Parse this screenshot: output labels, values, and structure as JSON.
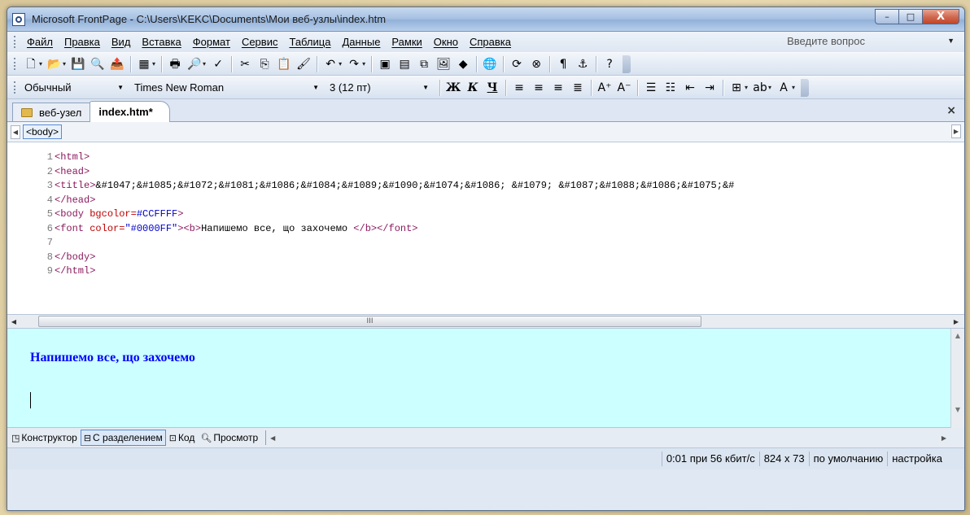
{
  "window": {
    "title": "Microsoft FrontPage - C:\\Users\\KEKC\\Documents\\Мои веб-узлы\\index.htm",
    "minimize": "–",
    "maximize": "□",
    "close": "X"
  },
  "menu": {
    "items": [
      "Файл",
      "Правка",
      "Вид",
      "Вставка",
      "Формат",
      "Сервис",
      "Таблица",
      "Данные",
      "Рамки",
      "Окно",
      "Справка"
    ],
    "ask_placeholder": "Введите вопрос",
    "ask_dropdown": "▼"
  },
  "toolbar_standard": {
    "icons": [
      {
        "name": "new-page-icon",
        "glyph": "🗋",
        "dropdown": true
      },
      {
        "name": "open-folder-icon",
        "glyph": "📂",
        "dropdown": true
      },
      {
        "name": "save-icon",
        "glyph": "💾"
      },
      {
        "name": "search-icon",
        "glyph": "🔍"
      },
      {
        "name": "publish-icon",
        "glyph": "📤"
      },
      {
        "name": "sep"
      },
      {
        "name": "toggle-pane-icon",
        "glyph": "▦",
        "dropdown": true
      },
      {
        "name": "sep"
      },
      {
        "name": "print-icon",
        "glyph": "🖶"
      },
      {
        "name": "print-preview-icon",
        "glyph": "🔎",
        "dropdown": true
      },
      {
        "name": "spelling-icon",
        "glyph": "✓"
      },
      {
        "name": "sep"
      },
      {
        "name": "cut-icon",
        "glyph": "✂"
      },
      {
        "name": "copy-icon",
        "glyph": "⎘"
      },
      {
        "name": "paste-icon",
        "glyph": "📋"
      },
      {
        "name": "format-painter-icon",
        "glyph": "🖌"
      },
      {
        "name": "sep"
      },
      {
        "name": "undo-icon",
        "glyph": "↶",
        "dropdown": true
      },
      {
        "name": "redo-icon",
        "glyph": "↷",
        "dropdown": true
      },
      {
        "name": "sep"
      },
      {
        "name": "web-component-icon",
        "glyph": "▣"
      },
      {
        "name": "insert-table-icon",
        "glyph": "▤"
      },
      {
        "name": "insert-layer-icon",
        "glyph": "⧉"
      },
      {
        "name": "insert-picture-icon",
        "glyph": "🖼"
      },
      {
        "name": "drawing-icon",
        "glyph": "◆"
      },
      {
        "name": "sep"
      },
      {
        "name": "hyperlink-icon",
        "glyph": "🌐"
      },
      {
        "name": "sep"
      },
      {
        "name": "refresh-icon",
        "glyph": "⟳"
      },
      {
        "name": "stop-icon",
        "glyph": "⊗"
      },
      {
        "name": "sep"
      },
      {
        "name": "show-all-icon",
        "glyph": "¶"
      },
      {
        "name": "anchor-icon",
        "glyph": "⚓"
      },
      {
        "name": "sep"
      },
      {
        "name": "help-icon",
        "glyph": "?"
      }
    ]
  },
  "toolbar_formatting": {
    "style": "Обычный",
    "font": "Times New Roman",
    "size": "3 (12 пт)",
    "bold": "Ж",
    "italic": "К",
    "underline": "Ч",
    "icons": [
      {
        "name": "align-left-icon",
        "glyph": "≡"
      },
      {
        "name": "align-center-icon",
        "glyph": "≡"
      },
      {
        "name": "align-right-icon",
        "glyph": "≡"
      },
      {
        "name": "justify-icon",
        "glyph": "≣"
      },
      {
        "name": "sep"
      },
      {
        "name": "increase-font-icon",
        "glyph": "A⁺"
      },
      {
        "name": "decrease-font-icon",
        "glyph": "A⁻"
      },
      {
        "name": "sep"
      },
      {
        "name": "numbered-list-icon",
        "glyph": "☰"
      },
      {
        "name": "bulleted-list-icon",
        "glyph": "☷"
      },
      {
        "name": "decrease-indent-icon",
        "glyph": "⇤"
      },
      {
        "name": "increase-indent-icon",
        "glyph": "⇥"
      },
      {
        "name": "sep"
      },
      {
        "name": "borders-icon",
        "glyph": "⊞",
        "dropdown": true
      },
      {
        "name": "highlight-icon",
        "glyph": "ab",
        "dropdown": true
      },
      {
        "name": "font-color-icon",
        "glyph": "A",
        "dropdown": true
      }
    ]
  },
  "tabs": {
    "site": "веб-узел",
    "document": "index.htm*",
    "close": "×"
  },
  "tag_selector": {
    "tag": "<body>"
  },
  "code": {
    "lines": [
      {
        "n": "1",
        "parts": [
          {
            "c": "tag",
            "t": "<html>"
          }
        ]
      },
      {
        "n": "2",
        "parts": [
          {
            "c": "tag",
            "t": "<head>"
          }
        ]
      },
      {
        "n": "3",
        "parts": [
          {
            "c": "tag",
            "t": "<title>"
          },
          {
            "c": "txt",
            "t": "&#1047;&#1085;&#1072;&#1081;&#1086;&#1084;&#1089;&#1090;&#1074;&#1086; &#1079; &#1087;&#1088;&#1086;&#1075;&#"
          }
        ]
      },
      {
        "n": "4",
        "parts": [
          {
            "c": "tag",
            "t": "</head>"
          }
        ]
      },
      {
        "n": "5",
        "parts": [
          {
            "c": "tag",
            "t": "<body "
          },
          {
            "c": "attr",
            "t": "bgcolor="
          },
          {
            "c": "val",
            "t": "#CCFFFF"
          },
          {
            "c": "tag",
            "t": ">"
          }
        ]
      },
      {
        "n": "6",
        "parts": [
          {
            "c": "tag",
            "t": "<font "
          },
          {
            "c": "attr",
            "t": "color="
          },
          {
            "c": "val",
            "t": "\"#0000FF\""
          },
          {
            "c": "tag",
            "t": "><b>"
          },
          {
            "c": "txt",
            "t": "Напишемо все, що захочемо "
          },
          {
            "c": "tag",
            "t": "</b></font>"
          }
        ]
      },
      {
        "n": "7",
        "parts": []
      },
      {
        "n": "8",
        "parts": [
          {
            "c": "tag",
            "t": "</body>"
          }
        ]
      },
      {
        "n": "9",
        "parts": [
          {
            "c": "tag",
            "t": "</html>"
          }
        ]
      }
    ]
  },
  "design": {
    "text": "Напишемо все, що захочемо",
    "background": "#CCFFFF",
    "text_color": "#0000FF"
  },
  "view_tabs": {
    "design": "Конструктор",
    "split": "С разделением",
    "code": "Код",
    "preview": "Просмотр"
  },
  "status": {
    "download": "0:01 при 56 кбит/с",
    "size": "824 x 73",
    "default": "по умолчанию",
    "custom": "настройка"
  },
  "scroll": {
    "thumb_grip": "III"
  }
}
